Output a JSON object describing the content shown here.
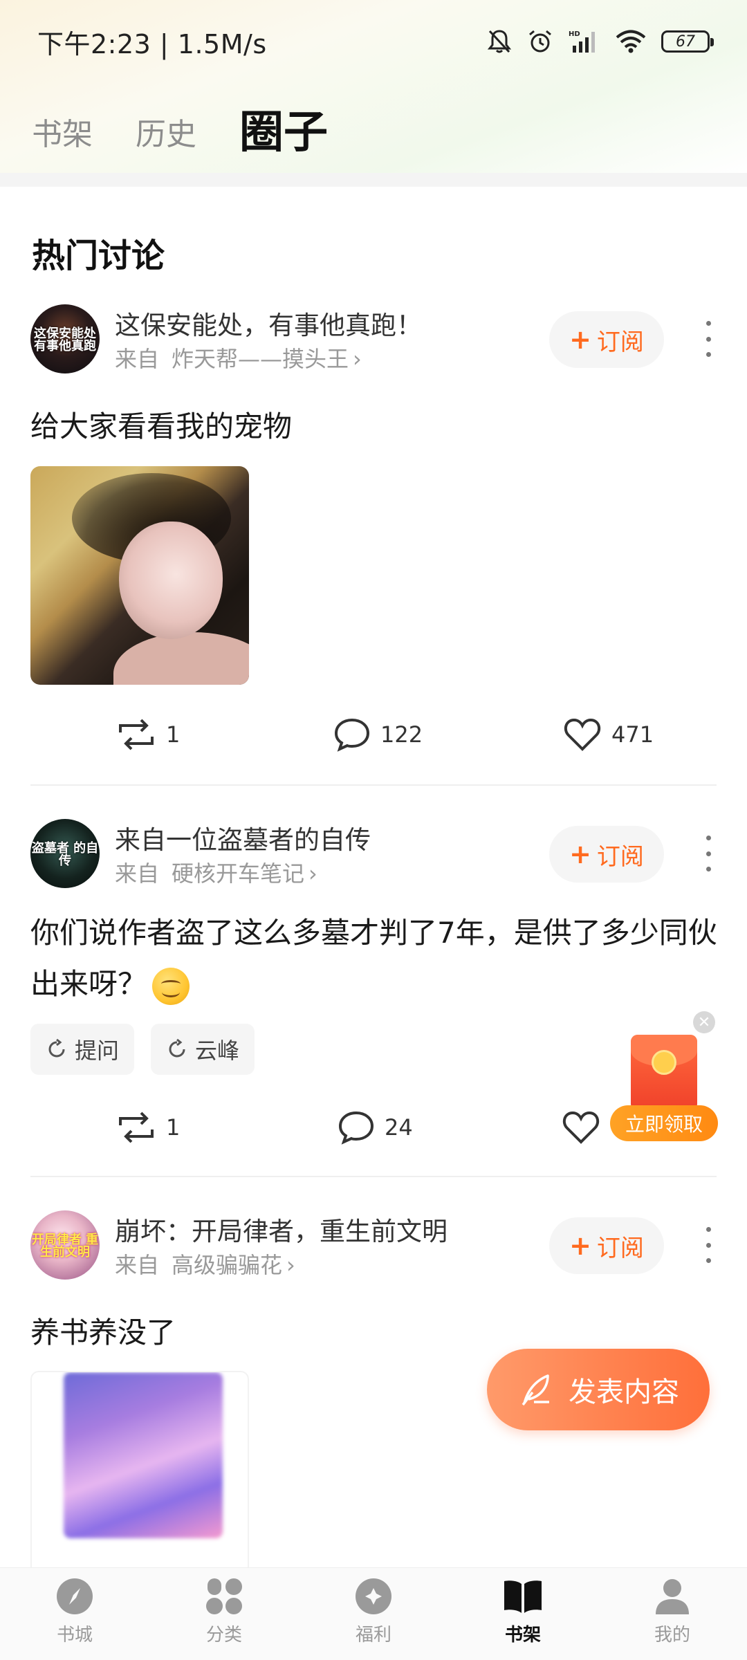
{
  "status_bar": {
    "time": "下午2:23 | 1.5M/s",
    "battery": "67"
  },
  "top_tabs": [
    {
      "label": "书架",
      "active": false
    },
    {
      "label": "历史",
      "active": false
    },
    {
      "label": "圈子",
      "active": true
    }
  ],
  "section_title": "热门讨论",
  "subscribe_label": "订阅",
  "from_label": "来自",
  "posts": [
    {
      "book_title": "这保安能处，有事他真跑！",
      "avatar_text": "这保安能处 有事他真跑",
      "author": "炸天帮——摸头王",
      "body": "给大家看看我的宠物",
      "reposts": "1",
      "comments": "122",
      "likes": "471"
    },
    {
      "book_title": "来自一位盗墓者的自传",
      "avatar_text": "盗墓者 的自传",
      "author": "硬核开车笔记",
      "body": "你们说作者盗了这么多墓才判了7年，是供了多少同伙出来呀？",
      "tags": [
        "提问",
        "云峰"
      ],
      "reposts": "1",
      "comments": "24"
    },
    {
      "book_title": "崩坏：开局律者，重生前文明",
      "avatar_text": "开局律者 重生前文明",
      "author": "高级骗骗花",
      "body": "养书养没了"
    }
  ],
  "red_packet": {
    "label": "立即领取"
  },
  "publish_button": "发表内容",
  "bottom_nav": [
    {
      "label": "书城",
      "icon": "compass-icon",
      "active": false
    },
    {
      "label": "分类",
      "icon": "grid-icon",
      "active": false
    },
    {
      "label": "福利",
      "icon": "gift-icon",
      "active": false
    },
    {
      "label": "书架",
      "icon": "book-open-icon",
      "active": true
    },
    {
      "label": "我的",
      "icon": "user-icon",
      "active": false
    }
  ],
  "colors": {
    "accent": "#ff6a1f",
    "publish_gradient_start": "#ff9a6a",
    "publish_gradient_end": "#ff6f3a"
  }
}
